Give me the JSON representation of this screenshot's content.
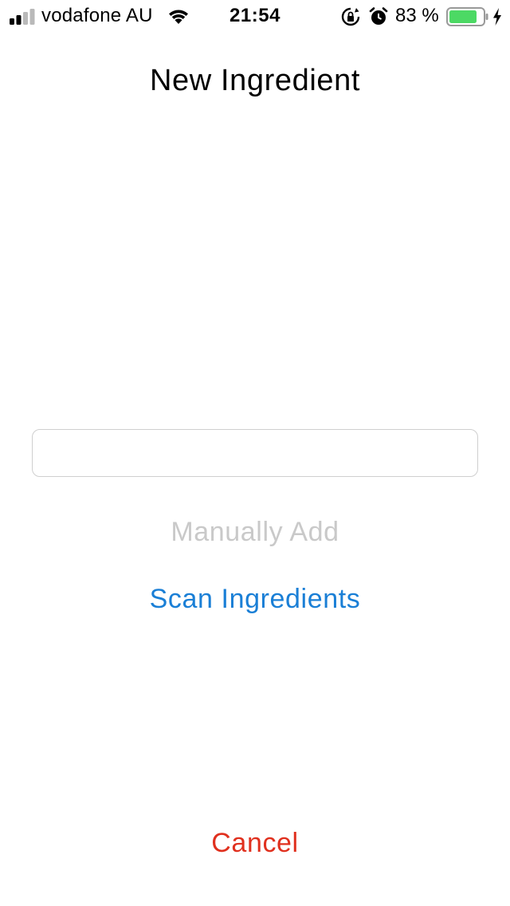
{
  "status_bar": {
    "carrier": "vodafone AU",
    "time": "21:54",
    "battery_percent": "83 %",
    "battery_level": 0.83,
    "battery_color": "#4cd964",
    "icons": [
      "signal-icon",
      "wifi-icon",
      "orientation-lock-icon",
      "alarm-icon",
      "battery-icon",
      "charging-bolt-icon"
    ]
  },
  "header": {
    "title": "New Ingredient"
  },
  "form": {
    "ingredient_value": "",
    "ingredient_placeholder": ""
  },
  "actions": {
    "manual_add_label": "Manually Add",
    "scan_label": "Scan Ingredients",
    "cancel_label": "Cancel"
  },
  "colors": {
    "disabled": "#c9c9c9",
    "link_blue": "#1a7fd6",
    "destructive_red": "#e0301e"
  }
}
